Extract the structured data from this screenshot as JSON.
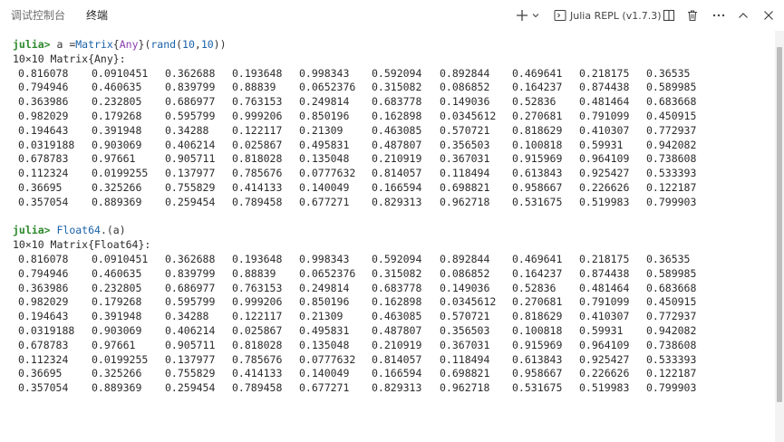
{
  "tabs": [
    {
      "label": "调试控制台",
      "active": false
    },
    {
      "label": "终端",
      "active": true
    }
  ],
  "toolbar": {
    "terminal_title": "Julia REPL (v1.7.3)",
    "icons": [
      "plus-icon",
      "chevron-down-icon",
      "terminal-icon",
      "split-icon",
      "trash-icon",
      "more-icon",
      "chevron-up-icon",
      "close-icon"
    ]
  },
  "colors": {
    "prompt": "#2c8a2c",
    "function": "#1a62a8",
    "type": "#8a3fb0",
    "text": "#2b2b2b"
  },
  "repl": {
    "blocks": [
      {
        "prompt": "julia>",
        "command_parts": [
          {
            "text": " a =",
            "kind": "plain"
          },
          {
            "text": "Matrix",
            "kind": "fn"
          },
          {
            "text": "{",
            "kind": "plain"
          },
          {
            "text": "Any",
            "kind": "kw"
          },
          {
            "text": "}(",
            "kind": "plain"
          },
          {
            "text": "rand",
            "kind": "fn"
          },
          {
            "text": "(",
            "kind": "plain"
          },
          {
            "text": "10",
            "kind": "num"
          },
          {
            "text": ",",
            "kind": "plain"
          },
          {
            "text": "10",
            "kind": "num"
          },
          {
            "text": "))",
            "kind": "plain"
          }
        ],
        "header": "10×10 Matrix{Any}:",
        "rows": [
          [
            "0.816078",
            "0.0910451",
            "0.362688",
            "0.193648",
            "0.998343",
            "0.592094",
            "0.892844",
            "0.469641",
            "0.218175",
            "0.36535"
          ],
          [
            "0.794946",
            "0.460635",
            "0.839799",
            "0.88839",
            "0.0652376",
            "0.315082",
            "0.086852",
            "0.164237",
            "0.874438",
            "0.589985"
          ],
          [
            "0.363986",
            "0.232805",
            "0.686977",
            "0.763153",
            "0.249814",
            "0.683778",
            "0.149036",
            "0.52836",
            "0.481464",
            "0.683668"
          ],
          [
            "0.982029",
            "0.179268",
            "0.595799",
            "0.999206",
            "0.850196",
            "0.162898",
            "0.0345612",
            "0.270681",
            "0.791099",
            "0.450915"
          ],
          [
            "0.194643",
            "0.391948",
            "0.34288",
            "0.122117",
            "0.21309",
            "0.463085",
            "0.570721",
            "0.818629",
            "0.410307",
            "0.772937"
          ],
          [
            "0.0319188",
            "0.903069",
            "0.406214",
            "0.025867",
            "0.495831",
            "0.487807",
            "0.356503",
            "0.100818",
            "0.59931",
            "0.942082"
          ],
          [
            "0.678783",
            "0.97661",
            "0.905711",
            "0.818028",
            "0.135048",
            "0.210919",
            "0.367031",
            "0.915969",
            "0.964109",
            "0.738608"
          ],
          [
            "0.112324",
            "0.0199255",
            "0.137977",
            "0.785676",
            "0.0777632",
            "0.814057",
            "0.118494",
            "0.613843",
            "0.925427",
            "0.533393"
          ],
          [
            "0.36695",
            "0.325266",
            "0.755829",
            "0.414133",
            "0.140049",
            "0.166594",
            "0.698821",
            "0.958667",
            "0.226626",
            "0.122187"
          ],
          [
            "0.357054",
            "0.889369",
            "0.259454",
            "0.789458",
            "0.677271",
            "0.829313",
            "0.962718",
            "0.531675",
            "0.519983",
            "0.799903"
          ]
        ]
      },
      {
        "prompt": "julia>",
        "command_parts": [
          {
            "text": " ",
            "kind": "plain"
          },
          {
            "text": "Float64",
            "kind": "fn"
          },
          {
            "text": ".(a)",
            "kind": "plain"
          }
        ],
        "header": "10×10 Matrix{Float64}:",
        "rows": [
          [
            "0.816078",
            "0.0910451",
            "0.362688",
            "0.193648",
            "0.998343",
            "0.592094",
            "0.892844",
            "0.469641",
            "0.218175",
            "0.36535"
          ],
          [
            "0.794946",
            "0.460635",
            "0.839799",
            "0.88839",
            "0.0652376",
            "0.315082",
            "0.086852",
            "0.164237",
            "0.874438",
            "0.589985"
          ],
          [
            "0.363986",
            "0.232805",
            "0.686977",
            "0.763153",
            "0.249814",
            "0.683778",
            "0.149036",
            "0.52836",
            "0.481464",
            "0.683668"
          ],
          [
            "0.982029",
            "0.179268",
            "0.595799",
            "0.999206",
            "0.850196",
            "0.162898",
            "0.0345612",
            "0.270681",
            "0.791099",
            "0.450915"
          ],
          [
            "0.194643",
            "0.391948",
            "0.34288",
            "0.122117",
            "0.21309",
            "0.463085",
            "0.570721",
            "0.818629",
            "0.410307",
            "0.772937"
          ],
          [
            "0.0319188",
            "0.903069",
            "0.406214",
            "0.025867",
            "0.495831",
            "0.487807",
            "0.356503",
            "0.100818",
            "0.59931",
            "0.942082"
          ],
          [
            "0.678783",
            "0.97661",
            "0.905711",
            "0.818028",
            "0.135048",
            "0.210919",
            "0.367031",
            "0.915969",
            "0.964109",
            "0.738608"
          ],
          [
            "0.112324",
            "0.0199255",
            "0.137977",
            "0.785676",
            "0.0777632",
            "0.814057",
            "0.118494",
            "0.613843",
            "0.925427",
            "0.533393"
          ],
          [
            "0.36695",
            "0.325266",
            "0.755829",
            "0.414133",
            "0.140049",
            "0.166594",
            "0.698821",
            "0.958667",
            "0.226626",
            "0.122187"
          ],
          [
            "0.357054",
            "0.889369",
            "0.259454",
            "0.789458",
            "0.677271",
            "0.829313",
            "0.962718",
            "0.531675",
            "0.519983",
            "0.799903"
          ]
        ]
      }
    ]
  }
}
